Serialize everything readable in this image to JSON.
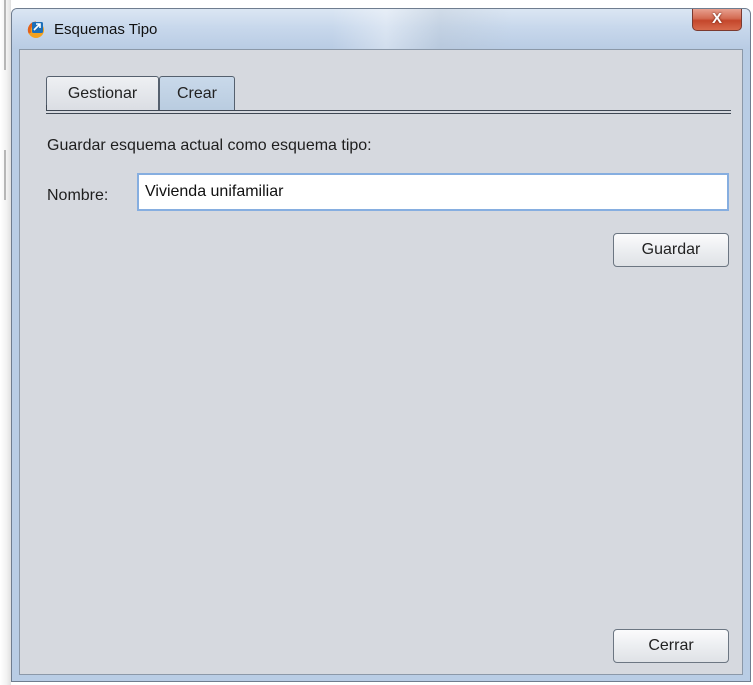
{
  "window": {
    "title": "Esquemas Tipo",
    "close_glyph": "X",
    "icon": "app-logo-icon"
  },
  "tabs": [
    {
      "label": "Gestionar",
      "selected": false
    },
    {
      "label": "Crear",
      "selected": true
    }
  ],
  "form": {
    "section_label": "Guardar esquema actual como esquema tipo:",
    "name_label": "Nombre:",
    "name_value": "Vivienda unifamiliar",
    "save_button": "Guardar"
  },
  "footer": {
    "close_button": "Cerrar"
  },
  "colors": {
    "title_bar": "#c8d8ec",
    "panel_background": "#d6d9df",
    "close_button": "#c4462b",
    "input_focus_border": "#86aee0"
  }
}
